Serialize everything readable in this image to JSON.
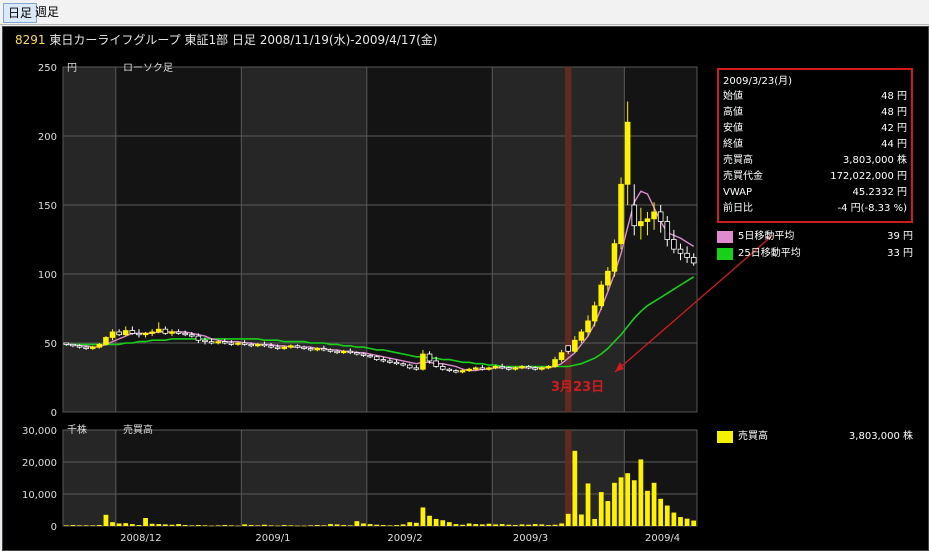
{
  "tabs": [
    {
      "label": "日足"
    },
    {
      "label": "週足"
    }
  ],
  "title": {
    "code": "8291",
    "text": "東日カーライフグループ 東証1部 日足 2008/11/19(水)-2009/4/17(金)"
  },
  "info_box": {
    "date": "2009/3/23(月)",
    "rows": [
      {
        "label": "始値",
        "value": "48 円"
      },
      {
        "label": "高値",
        "value": "48 円"
      },
      {
        "label": "安値",
        "value": "42 円"
      },
      {
        "label": "終値",
        "value": "44 円"
      },
      {
        "label": "売買高",
        "value": "3,803,000 株"
      },
      {
        "label": "売買代金",
        "value": "172,022,000 円"
      },
      {
        "label": "VWAP",
        "value": "45.2332 円"
      },
      {
        "label": "前日比",
        "value": "-4 円(-8.33 %)"
      }
    ]
  },
  "legend": [
    {
      "name": "5日移動平均",
      "value": "39 円",
      "color": "#e08ad0"
    },
    {
      "name": "25日移動平均",
      "value": "33 円",
      "color": "#18d018"
    }
  ],
  "volume_legend": {
    "name": "売買高",
    "value": "3,803,000 株",
    "color": "#f5ef00"
  },
  "annotation": "3月23日",
  "colors": {
    "up": "#fff200",
    "ma5": "#e08ad0",
    "ma25": "#18d018",
    "highlight": "#6b2a22",
    "callout": "#d01c1c"
  },
  "chart_data": [
    {
      "type": "candlestick",
      "price_panel_labels": {
        "unit": "円",
        "name": "ローソク足"
      },
      "y_ticks": [
        0,
        50,
        100,
        150,
        200,
        250
      ],
      "ylim": [
        0,
        250
      ],
      "x_labels": [
        "2008/12",
        "2009/1",
        "2009/2",
        "2009/3",
        "2009/4"
      ],
      "candles": [
        [
          50,
          50,
          48,
          49
        ],
        [
          49,
          49,
          47,
          48
        ],
        [
          48,
          49,
          46,
          47
        ],
        [
          47,
          48,
          45,
          46
        ],
        [
          46,
          48,
          45,
          47
        ],
        [
          47,
          50,
          46,
          49
        ],
        [
          49,
          55,
          48,
          54
        ],
        [
          54,
          60,
          52,
          58
        ],
        [
          58,
          60,
          55,
          56
        ],
        [
          56,
          62,
          55,
          59
        ],
        [
          59,
          62,
          56,
          57
        ],
        [
          57,
          60,
          54,
          56
        ],
        [
          56,
          58,
          54,
          57
        ],
        [
          57,
          60,
          55,
          58
        ],
        [
          58,
          65,
          57,
          60
        ],
        [
          60,
          62,
          56,
          57
        ],
        [
          57,
          60,
          55,
          58
        ],
        [
          58,
          60,
          56,
          57
        ],
        [
          57,
          59,
          55,
          56
        ],
        [
          56,
          58,
          54,
          55
        ],
        [
          55,
          57,
          50,
          52
        ],
        [
          52,
          54,
          49,
          51
        ],
        [
          51,
          53,
          49,
          50
        ],
        [
          50,
          52,
          49,
          51
        ],
        [
          51,
          53,
          49,
          50
        ],
        [
          50,
          52,
          48,
          49
        ],
        [
          49,
          51,
          48,
          50
        ],
        [
          50,
          52,
          48,
          49
        ],
        [
          49,
          50,
          47,
          48
        ],
        [
          48,
          50,
          47,
          49
        ],
        [
          49,
          51,
          47,
          48
        ],
        [
          48,
          50,
          46,
          47
        ],
        [
          47,
          49,
          45,
          46
        ],
        [
          46,
          48,
          45,
          47
        ],
        [
          47,
          49,
          46,
          48
        ],
        [
          48,
          49,
          46,
          47
        ],
        [
          47,
          48,
          45,
          46
        ],
        [
          46,
          47,
          44,
          45
        ],
        [
          45,
          47,
          44,
          46
        ],
        [
          46,
          48,
          44,
          45
        ],
        [
          45,
          46,
          43,
          44
        ],
        [
          44,
          45,
          42,
          43
        ],
        [
          43,
          45,
          42,
          44
        ],
        [
          44,
          46,
          42,
          43
        ],
        [
          43,
          44,
          41,
          42
        ],
        [
          42,
          43,
          40,
          41
        ],
        [
          41,
          42,
          39,
          40
        ],
        [
          40,
          41,
          37,
          38
        ],
        [
          38,
          40,
          36,
          37
        ],
        [
          37,
          39,
          35,
          36
        ],
        [
          36,
          38,
          34,
          35
        ],
        [
          35,
          36,
          33,
          34
        ],
        [
          34,
          35,
          31,
          32
        ],
        [
          32,
          34,
          30,
          31
        ],
        [
          31,
          45,
          30,
          42
        ],
        [
          42,
          44,
          35,
          37
        ],
        [
          37,
          40,
          32,
          33
        ],
        [
          33,
          35,
          30,
          31
        ],
        [
          31,
          32,
          29,
          30
        ],
        [
          30,
          31,
          28,
          29
        ],
        [
          29,
          31,
          28,
          30
        ],
        [
          30,
          32,
          29,
          31
        ],
        [
          31,
          33,
          30,
          32
        ],
        [
          32,
          34,
          30,
          31
        ],
        [
          31,
          33,
          30,
          32
        ],
        [
          32,
          34,
          31,
          33
        ],
        [
          33,
          35,
          31,
          32
        ],
        [
          32,
          33,
          30,
          31
        ],
        [
          31,
          33,
          30,
          32
        ],
        [
          32,
          34,
          31,
          33
        ],
        [
          33,
          34,
          31,
          32
        ],
        [
          32,
          33,
          30,
          31
        ],
        [
          31,
          33,
          30,
          32
        ],
        [
          32,
          34,
          31,
          33
        ],
        [
          33,
          40,
          32,
          38
        ],
        [
          38,
          45,
          36,
          43
        ],
        [
          48,
          48,
          42,
          44
        ],
        [
          44,
          55,
          43,
          52
        ],
        [
          52,
          60,
          50,
          58
        ],
        [
          58,
          70,
          55,
          66
        ],
        [
          66,
          80,
          62,
          77
        ],
        [
          77,
          95,
          74,
          92
        ],
        [
          92,
          105,
          88,
          102
        ],
        [
          102,
          125,
          98,
          122
        ],
        [
          122,
          170,
          118,
          165
        ],
        [
          165,
          225,
          150,
          210
        ],
        [
          150,
          165,
          128,
          135
        ],
        [
          135,
          148,
          125,
          138
        ],
        [
          138,
          145,
          128,
          140
        ],
        [
          140,
          152,
          132,
          145
        ],
        [
          145,
          150,
          130,
          138
        ],
        [
          138,
          142,
          120,
          125
        ],
        [
          125,
          132,
          115,
          118
        ],
        [
          118,
          122,
          110,
          115
        ],
        [
          115,
          120,
          108,
          112
        ],
        [
          112,
          115,
          106,
          108
        ]
      ],
      "ma5": [
        49,
        49,
        48,
        48,
        47,
        47,
        49,
        51,
        53,
        55,
        57,
        57,
        57,
        57,
        58,
        58,
        58,
        58,
        58,
        57,
        56,
        55,
        53,
        52,
        51,
        51,
        51,
        50,
        50,
        49,
        49,
        49,
        48,
        48,
        47,
        47,
        47,
        47,
        46,
        46,
        45,
        45,
        44,
        44,
        43,
        43,
        42,
        41,
        40,
        39,
        38,
        37,
        36,
        35,
        36,
        36,
        35,
        35,
        34,
        33,
        31,
        30,
        30,
        31,
        31,
        32,
        32,
        32,
        32,
        32,
        32,
        32,
        32,
        32,
        33,
        35,
        39,
        43,
        49,
        55,
        64,
        75,
        87,
        100,
        115,
        134,
        152,
        160,
        158,
        148,
        138,
        130,
        128,
        126,
        123,
        120
      ],
      "ma25": [
        49,
        49,
        49,
        49,
        49,
        49,
        49,
        49,
        49,
        50,
        50,
        51,
        51,
        52,
        52,
        52,
        53,
        53,
        53,
        53,
        53,
        53,
        53,
        53,
        53,
        53,
        53,
        53,
        53,
        53,
        52,
        52,
        52,
        51,
        51,
        51,
        51,
        50,
        50,
        50,
        49,
        49,
        48,
        48,
        47,
        47,
        46,
        45,
        45,
        44,
        43,
        42,
        41,
        40,
        40,
        39,
        39,
        38,
        38,
        37,
        36,
        36,
        35,
        35,
        34,
        34,
        33,
        33,
        33,
        33,
        33,
        33,
        33,
        33,
        33,
        33,
        33,
        34,
        35,
        37,
        39,
        42,
        46,
        51,
        56,
        62,
        68,
        73,
        77,
        80,
        83,
        86,
        89,
        92,
        95,
        98
      ]
    },
    {
      "type": "bar",
      "panel_labels": {
        "unit": "千株",
        "name": "売買高"
      },
      "y_ticks": [
        0,
        10000,
        20000,
        30000
      ],
      "ylim": [
        0,
        30000
      ],
      "values": [
        200,
        300,
        200,
        200,
        200,
        300,
        3500,
        1200,
        800,
        900,
        600,
        300,
        2500,
        700,
        600,
        500,
        400,
        600,
        300,
        200,
        300,
        200,
        100,
        200,
        300,
        200,
        100,
        500,
        300,
        200,
        400,
        200,
        100,
        300,
        200,
        100,
        100,
        200,
        300,
        200,
        600,
        500,
        300,
        200,
        1500,
        800,
        600,
        400,
        300,
        200,
        300,
        500,
        1200,
        1000,
        5800,
        3200,
        2200,
        1800,
        1200,
        600,
        400,
        800,
        600,
        500,
        700,
        500,
        600,
        400,
        300,
        500,
        400,
        600,
        500,
        300,
        400,
        800,
        3803,
        23500,
        3600,
        13300,
        2200,
        10600,
        7800,
        13500,
        15200,
        16500,
        14300,
        20800,
        11000,
        13500,
        8500,
        6400,
        4200,
        2800,
        2300,
        1700
      ]
    }
  ]
}
